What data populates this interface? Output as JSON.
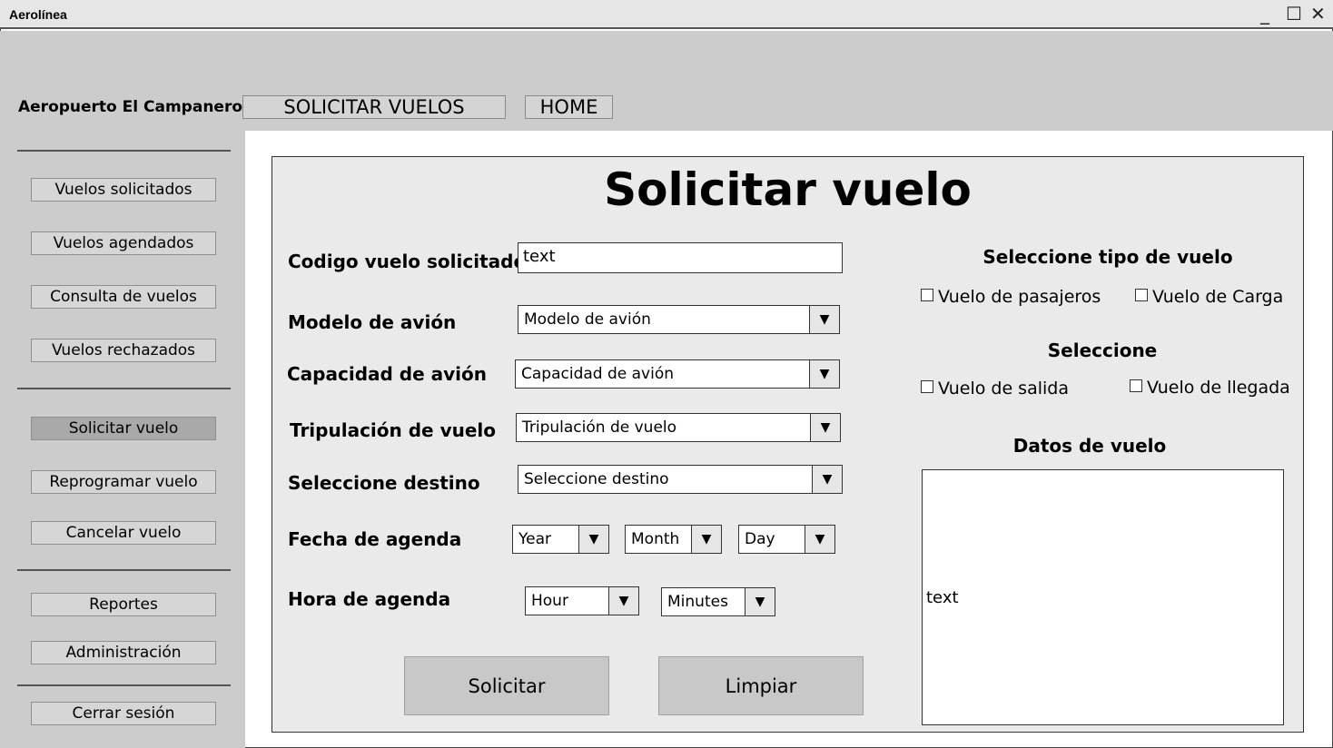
{
  "window": {
    "title": "Aerolínea",
    "minimize": "_",
    "maximize": "☐",
    "close": "✕"
  },
  "header": {
    "brand": "Aeropuerto El Campanero",
    "nav": [
      "SOLICITAR VUELOS",
      "HOME"
    ]
  },
  "sidebar": {
    "group1": [
      "Vuelos solicitados",
      "Vuelos agendados",
      "Consulta de vuelos",
      "Vuelos rechazados"
    ],
    "group2": [
      "Solicitar vuelo",
      "Reprogramar vuelo",
      "Cancelar vuelo"
    ],
    "group3": [
      "Reportes",
      "Administración"
    ],
    "logout": "Cerrar sesión",
    "active": "Solicitar vuelo"
  },
  "form": {
    "title": "Solicitar vuelo",
    "codigo": {
      "label": "Codigo vuelo solicitado",
      "value": "text"
    },
    "modelo": {
      "label": "Modelo de avión",
      "value": "Modelo de avión"
    },
    "capacidad": {
      "label": "Capacidad de avión",
      "value": "Capacidad de avión"
    },
    "tripulacion": {
      "label": "Tripulación de vuelo",
      "value": "Tripulación de vuelo"
    },
    "destino": {
      "label": "Seleccione destino",
      "value": "Seleccione destino"
    },
    "fecha": {
      "label": "Fecha de agenda",
      "year": "Year",
      "month": "Month",
      "day": "Day"
    },
    "hora": {
      "label": "Hora de agenda",
      "hour": "Hour",
      "minutes": "Minutes"
    },
    "buttons": {
      "submit": "Solicitar",
      "clear": "Limpiar"
    }
  },
  "right": {
    "tipo_title": "Seleccione tipo de vuelo",
    "tipo_options": [
      "Vuelo de pasajeros",
      "Vuelo de Carga"
    ],
    "sel_title": "Seleccione",
    "sel_options": [
      "Vuelo de salida",
      "Vuelo de llegada"
    ],
    "datos_title": "Datos de vuelo",
    "datos_value": "text"
  },
  "icons": {
    "dropdown": "▼"
  }
}
